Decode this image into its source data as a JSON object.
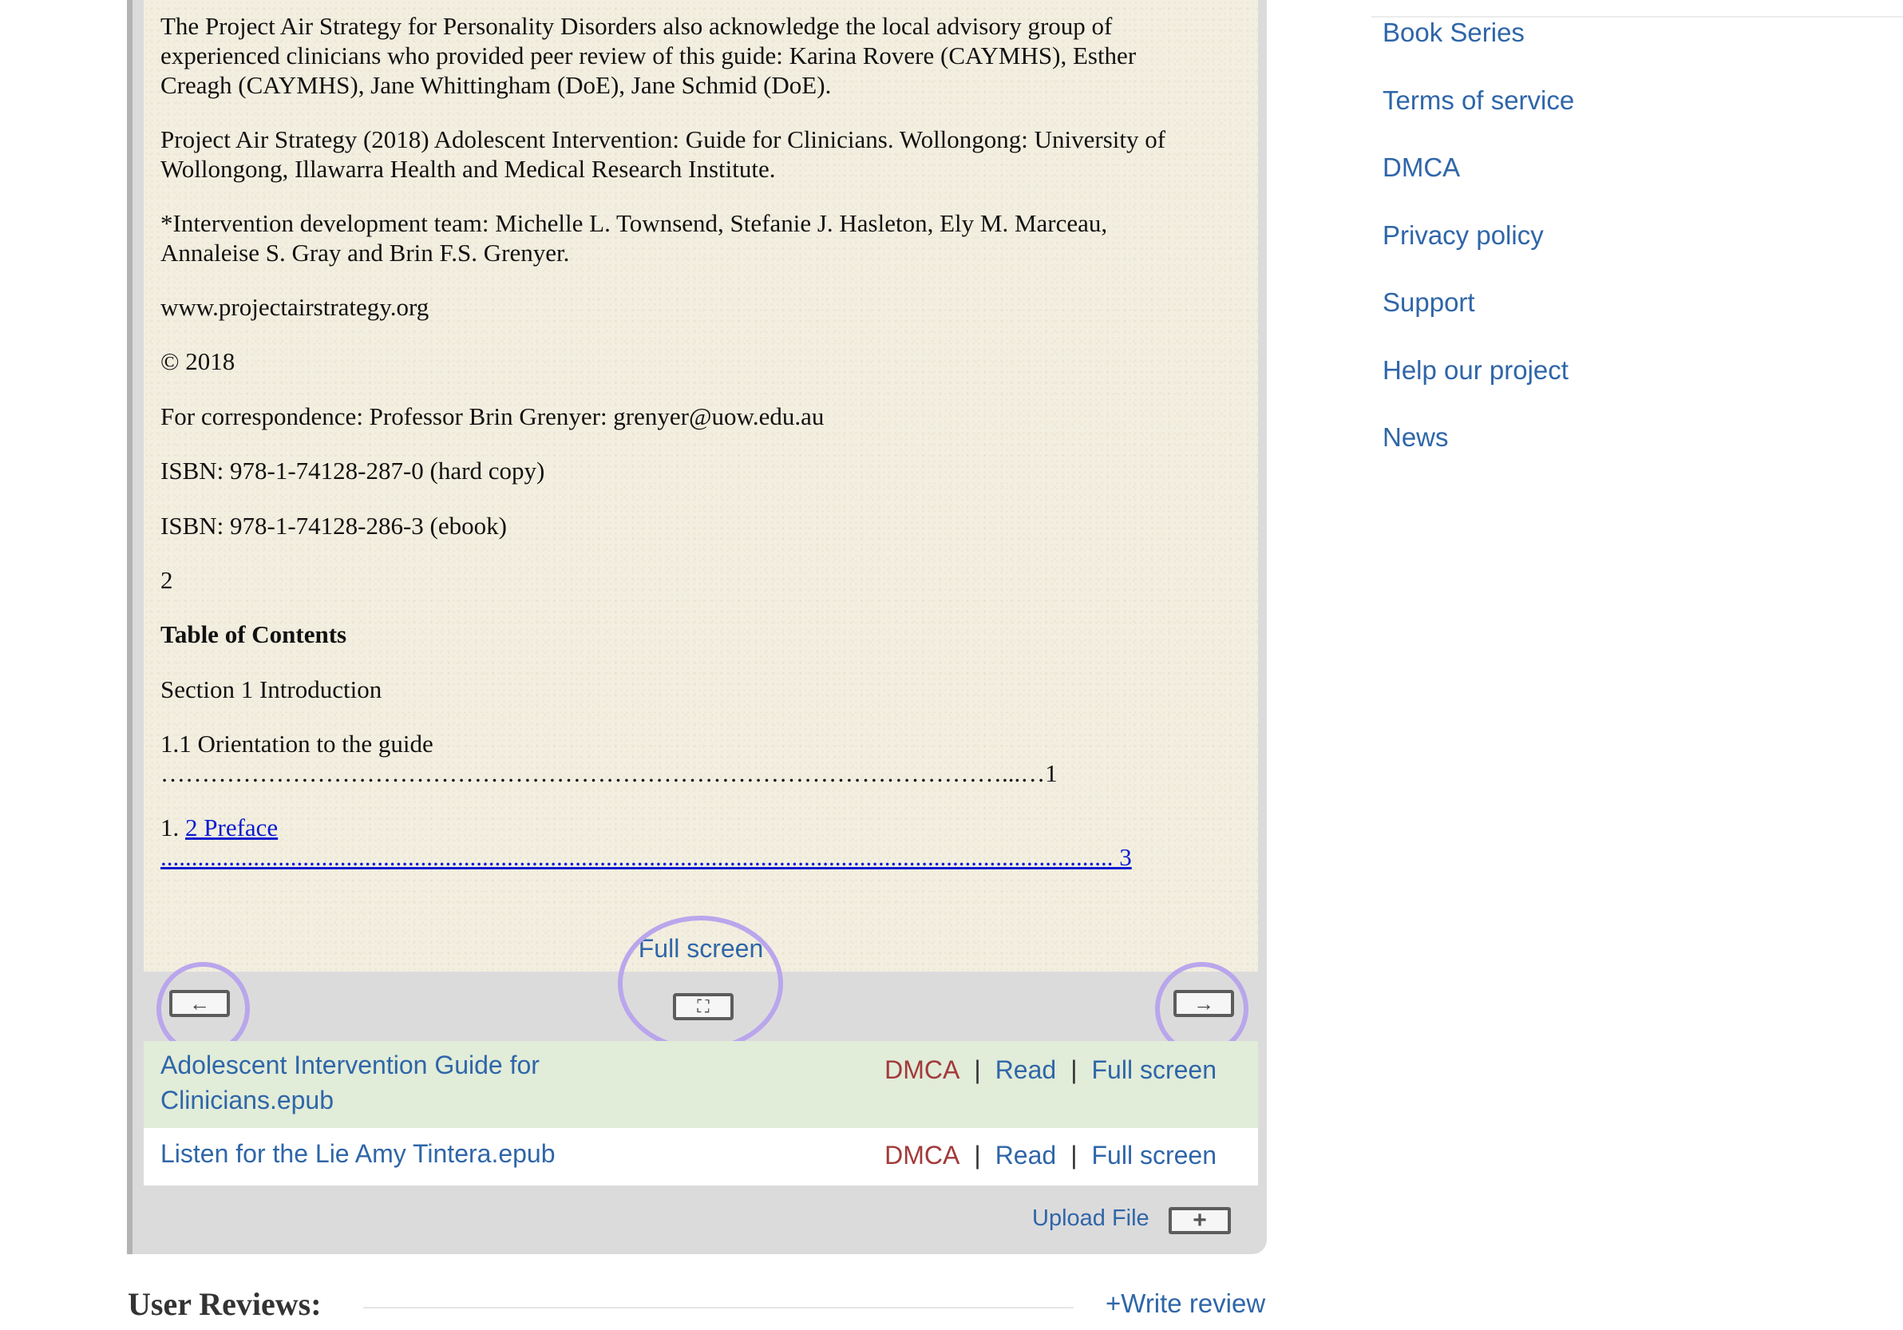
{
  "book": {
    "paragraphs": [
      "The Project Air Strategy for Personality Disorders also acknowledge the local advisory group of",
      "experienced clinicians who provided peer review of this guide: Karina Rovere (CAYMHS), Esther",
      "Creagh (CAYMHS), Jane Whittingham (DoE), Jane Schmid (DoE).",
      "Project Air Strategy (2018) Adolescent Intervention: Guide for Clinicians. Wollongong: University of",
      "Wollongong, Illawarra Health and Medical Research Institute.",
      "*Intervention development team: Michelle L. Townsend, Stefanie J. Hasleton, Ely M. Marceau,",
      "Annaleise S. Gray and Brin F.S. Grenyer.",
      "www.projectairstrategy.org",
      "© 2018",
      "For correspondence: Professor Brin Grenyer: grenyer@uow.edu.au",
      "ISBN: 978-1-74128-287-0 (hard copy)",
      "ISBN: 978-1-74128-286-3 (ebook)",
      "2"
    ],
    "toc_heading": "Table of Contents",
    "section_1": "Section 1 Introduction",
    "toc_item_1": "1.1 Orientation to the guide",
    "toc_item_1_dots": "…………………………………………………………………………………………...…1",
    "toc_item_2_prefix": "1. ",
    "toc_item_2_link": "2 Preface",
    "toc_item_2_dots": "..........................................................................................................................................................",
    "toc_item_2_page": " 3"
  },
  "reader": {
    "fullscreen_label": "Full screen",
    "prev_icon": "←",
    "next_icon": "→",
    "fullscreen_icon": "⛶"
  },
  "files": [
    {
      "name_line1": "Adolescent Intervention Guide for",
      "name_line2": "Clinicians.epub",
      "dmca": "DMCA",
      "read": "Read",
      "fullscreen": "Full screen",
      "sep": "|"
    },
    {
      "name_line1": "Listen for the Lie Amy Tintera.epub",
      "dmca": "DMCA",
      "read": "Read",
      "fullscreen": "Full screen",
      "sep": "|"
    }
  ],
  "upload": {
    "label": "Upload File",
    "icon": "+"
  },
  "reviews": {
    "title": "User Reviews:",
    "write": "+Write review"
  },
  "sidebar": {
    "links": [
      "Book Series",
      "Terms of service",
      "DMCA",
      "Privacy policy",
      "Support",
      "Help our project",
      "News"
    ]
  },
  "colors": {
    "link": "#2f66a8",
    "dmca": "#a23a3a",
    "ring": "#b9a6ec",
    "active_row": "#e1ecd9"
  }
}
